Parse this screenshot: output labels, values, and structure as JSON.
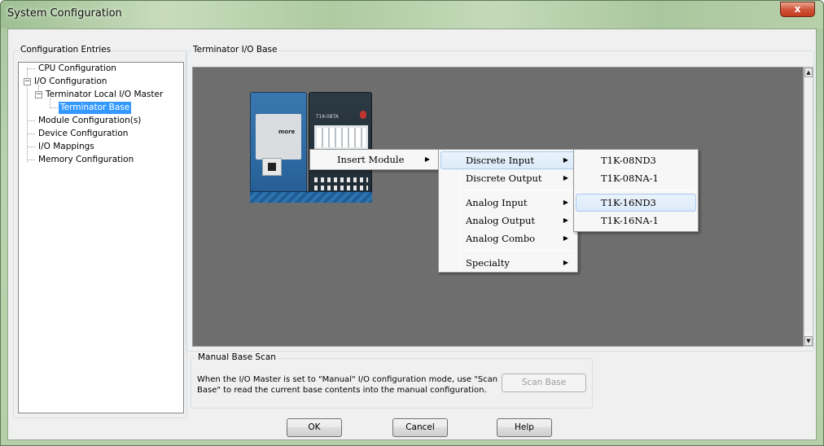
{
  "window": {
    "title": "System Configuration",
    "close_label": "x"
  },
  "tree": {
    "group_label": "Configuration Entries",
    "items": [
      {
        "label": "CPU Configuration"
      },
      {
        "label": "I/O Configuration",
        "expander": "−"
      },
      {
        "label": "Terminator Local I/O Master",
        "expander": "−"
      },
      {
        "label": "Terminator Base",
        "selected": true
      },
      {
        "label": "Module Configuration(s)"
      },
      {
        "label": "Device Configuration"
      },
      {
        "label": "I/O Mappings"
      },
      {
        "label": "Memory Configuration"
      }
    ]
  },
  "base": {
    "group_label": "Terminator I/O Base",
    "module_label": "T1K-08TA",
    "cpu_logo": "more"
  },
  "context_menu": {
    "level1": [
      {
        "label": "Insert Module",
        "arrow": "▶"
      }
    ],
    "level2": [
      {
        "label": "Discrete Input",
        "arrow": "▶",
        "hover": true
      },
      {
        "label": "Discrete Output",
        "arrow": "▶"
      },
      {
        "label": "Analog Input",
        "arrow": "▶"
      },
      {
        "label": "Analog Output",
        "arrow": "▶"
      },
      {
        "label": "Analog Combo",
        "arrow": "▶"
      },
      {
        "label": "Specialty",
        "arrow": "▶"
      }
    ],
    "level3": [
      {
        "label": "T1K-08ND3"
      },
      {
        "label": "T1K-08NA-1"
      },
      {
        "label": "T1K-16ND3",
        "hover": true
      },
      {
        "label": "T1K-16NA-1"
      }
    ]
  },
  "manual_scan": {
    "group_label": "Manual Base Scan",
    "description_line1": "When the I/O Master is set to \"Manual\" I/O configuration mode, use \"Scan",
    "description_line2": "Base\" to read the current base contents into the manual configuration.",
    "scan_button": "Scan Base"
  },
  "footer": {
    "ok": "OK",
    "cancel": "Cancel",
    "help": "Help"
  },
  "scrollbar": {
    "up_arrow": "▲",
    "down_arrow": "▼"
  }
}
